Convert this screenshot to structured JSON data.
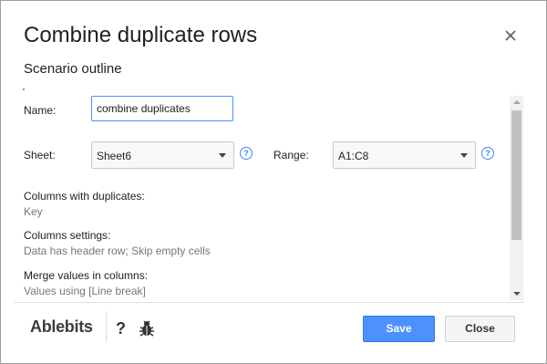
{
  "dialog": {
    "title": "Combine duplicate rows",
    "subtitle": "Scenario outline",
    "close_icon": "close-icon"
  },
  "form": {
    "name_label": "Name:",
    "name_value": "combine duplicates",
    "sheet_label": "Sheet:",
    "sheet_value": "Sheet6",
    "range_label": "Range:",
    "range_value": "A1:C8",
    "help_glyph": "?"
  },
  "sections": [
    {
      "heading": "Columns with duplicates:",
      "value": "Key"
    },
    {
      "heading": "Columns settings:",
      "value": "Data has header row; Skip empty cells"
    },
    {
      "heading": "Merge values in columns:",
      "value": "Values using [Line break]"
    }
  ],
  "footer": {
    "brand": "Ablebits",
    "help_glyph": "?",
    "save_label": "Save",
    "close_label": "Close"
  },
  "colors": {
    "accent": "#4d90fe",
    "help": "#4285f4"
  }
}
